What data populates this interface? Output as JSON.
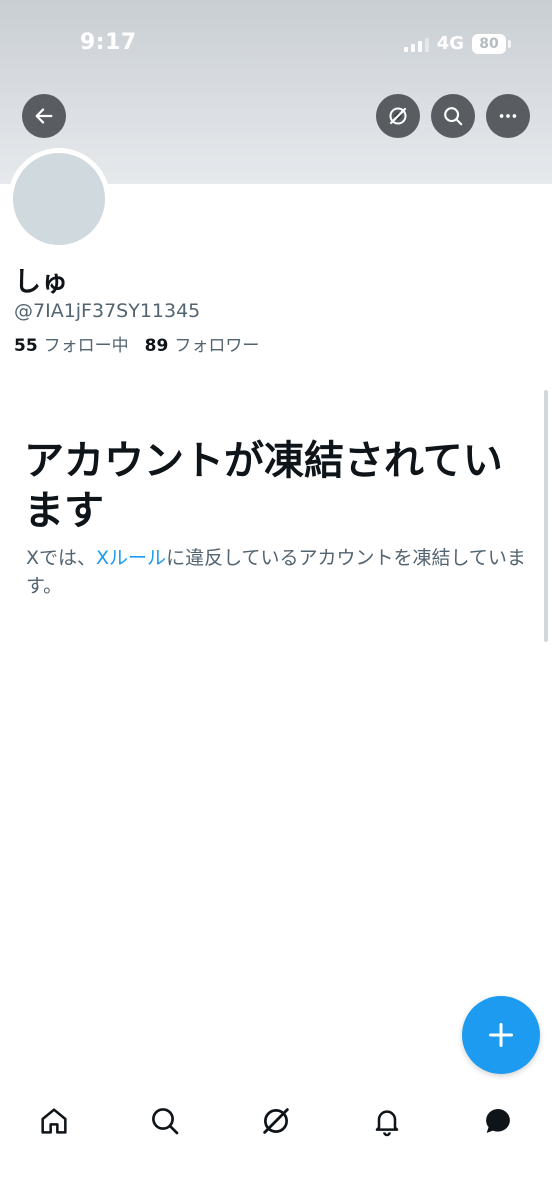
{
  "status_bar": {
    "time": "9:17",
    "network": "4G",
    "battery": "80"
  },
  "header": {
    "back_icon": "arrow-left-icon",
    "actions": [
      "grok-icon",
      "search-icon",
      "more-horizontal-icon"
    ]
  },
  "profile": {
    "display_name": "しゅ",
    "handle": "@7IA1jF37SY11345",
    "following_count": "55",
    "following_label": "フォロー中",
    "followers_count": "89",
    "followers_label": "フォロワー"
  },
  "suspension": {
    "title": "アカウントが凍結されています",
    "desc_prefix": "Xでは、",
    "desc_link": "Xルール",
    "desc_suffix": "に違反しているアカウントを凍結しています。"
  },
  "fab": {
    "icon": "plus-icon"
  },
  "bottom_nav": {
    "items": [
      "home-icon",
      "search-icon",
      "grok-icon",
      "notifications-bell-icon",
      "messages-icon"
    ]
  },
  "colors": {
    "accent": "#1d9bf0",
    "text_primary": "#0f1419",
    "text_secondary": "#536471",
    "avatar_placeholder": "#cfd9de"
  }
}
